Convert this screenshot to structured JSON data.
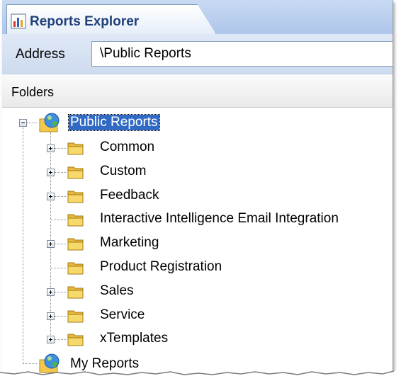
{
  "window": {
    "tab_title": "Reports Explorer",
    "tab_icon": "reports-chart-icon"
  },
  "address": {
    "label": "Address",
    "value": "\\Public Reports"
  },
  "folders_header": "Folders",
  "tree": {
    "root": {
      "label": "Public Reports",
      "icon": "globe-folder-icon",
      "expanded": true,
      "selected": true
    },
    "children": [
      {
        "label": "Common",
        "expandable": true
      },
      {
        "label": "Custom",
        "expandable": true
      },
      {
        "label": "Feedback",
        "expandable": true
      },
      {
        "label": "Interactive Intelligence Email Integration",
        "expandable": false
      },
      {
        "label": "Marketing",
        "expandable": true
      },
      {
        "label": "Product Registration",
        "expandable": false
      },
      {
        "label": "Sales",
        "expandable": true
      },
      {
        "label": "Service",
        "expandable": true
      },
      {
        "label": "xTemplates",
        "expandable": true
      }
    ],
    "second_root": {
      "label": "My Reports",
      "icon": "globe-folder-icon"
    }
  },
  "colors": {
    "selection": "#316ac5",
    "tab_text": "#1f3f7a",
    "header_blue": "#c9daf3",
    "folder_yellow": "#f7d96b"
  }
}
